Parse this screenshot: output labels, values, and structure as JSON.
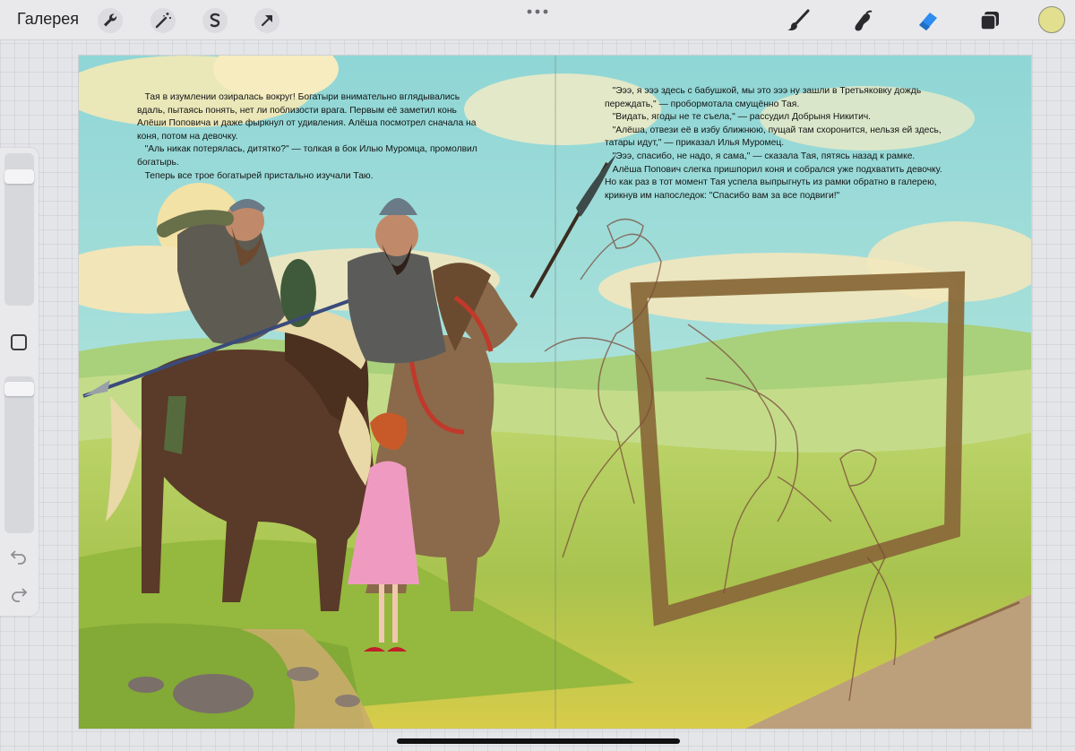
{
  "topbar": {
    "gallery_label": "Галерея",
    "left_tools": [
      "wrench-icon",
      "magic-wand-icon",
      "selection-s-icon",
      "transform-arrow-icon"
    ],
    "right_tools": [
      "brush-icon",
      "smudge-icon",
      "eraser-icon",
      "layers-icon"
    ],
    "active_tool": "eraser-icon",
    "current_color": "#e2df8e",
    "accent_color": "#2d8cf0"
  },
  "sidebar": {
    "brush_size_level": 0.88,
    "opacity_level": 0.96,
    "undo_icon": "undo-icon",
    "redo_icon": "redo-icon"
  },
  "page": {
    "left_text": "   Тая в изумлении озиралась вокруг! Богатыри внимательно вглядывались\nвдаль, пытаясь понять, нет ли поблизости врага. Первым её заметил конь\nАлёши Поповича и даже фыркнул от удивления. Алёша посмотрел сначала на\nконя, потом на девочку.\n   \"Аль никак потерялась, дитятко?\" — толкая в бок Илью Муромца, промолвил\nбогатырь.\n   Теперь все трое богатырей пристально изучали Таю.",
    "right_text": "   \"Эээ, я эээ здесь с бабушкой, мы это эээ ну зашли в Третьяковку дождь\nпереждать,\" — пробормотала смущённо Тая.\n   \"Видать, ягоды не те съела,\" — рассудил Добрыня Никитич.\n   \"Алёша, отвези её в избу ближнюю, пущай там схоронится, нельзя ей здесь,\nтатары идут,\" — приказал Илья Муромец.\n   \"Эээ, спасибо, не надо, я сама,\" — сказала Тая, пятясь назад к рамке.\n   Алёша Попович слегка пришпорил коня и собрался уже подхватить девочку.\nНо как раз в тот момент Тая успела выпрыгнуть из рамки обратно в галерею,\nкрикнув им напоследок: \"Спасибо вам за все подвиги!\""
  }
}
